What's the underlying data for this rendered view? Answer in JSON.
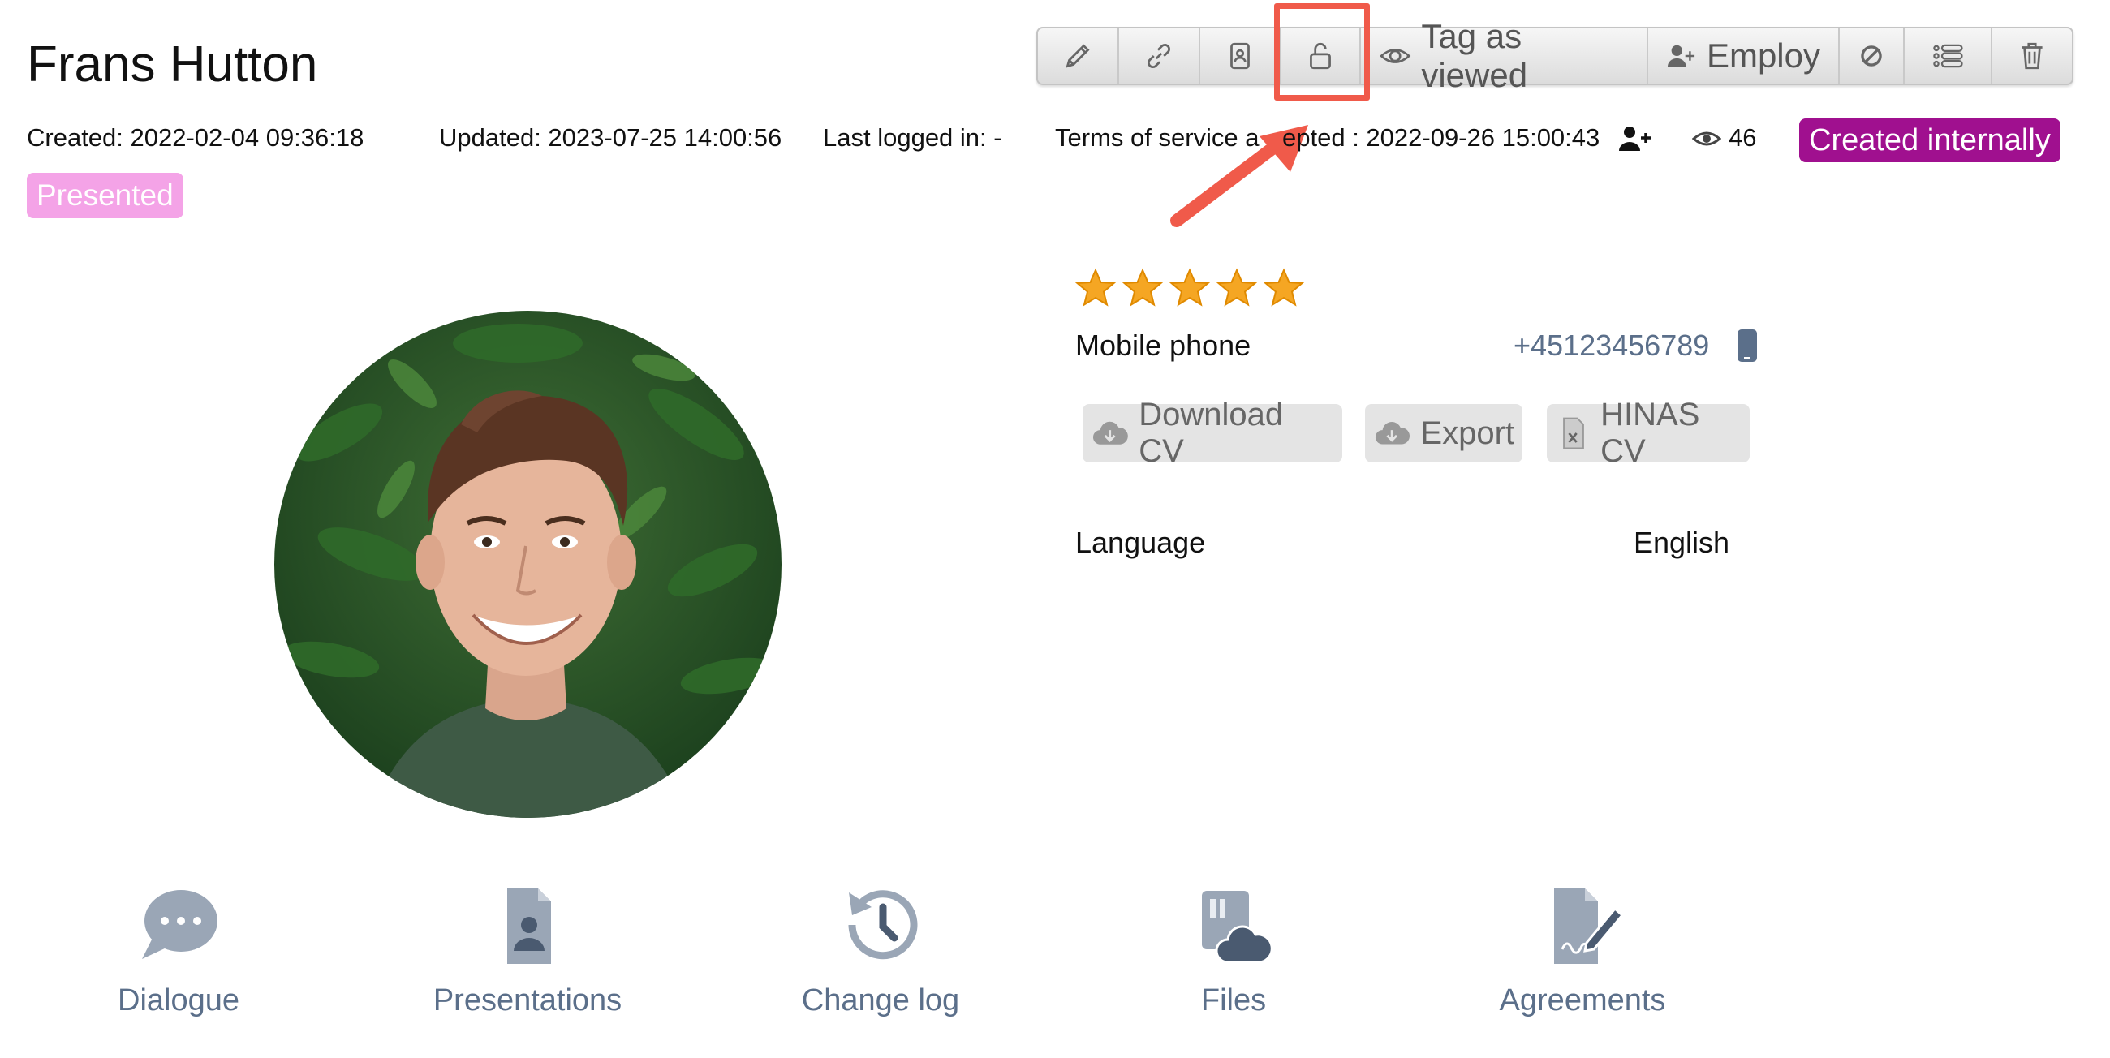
{
  "header": {
    "name": "Frans Hutton"
  },
  "toolbar": {
    "buttons": [
      {
        "icon": "pencil-icon",
        "label": ""
      },
      {
        "icon": "link-icon",
        "label": ""
      },
      {
        "icon": "contact-card-icon",
        "label": ""
      },
      {
        "icon": "unlock-icon",
        "label": ""
      },
      {
        "icon": "eye-icon",
        "label": "Tag as viewed"
      },
      {
        "icon": "user-plus-icon",
        "label": "Employ"
      },
      {
        "icon": "block-icon",
        "label": ""
      },
      {
        "icon": "list-icon",
        "label": ""
      },
      {
        "icon": "trash-icon",
        "label": ""
      }
    ],
    "tag_label": "Tag as viewed",
    "employ_label": "Employ"
  },
  "meta": {
    "created": "Created: 2022-02-04 09:36:18",
    "updated": "Updated: 2023-07-25 14:00:56",
    "last_logged_in": "Last logged in:   -",
    "terms_prefix": "Terms of service a",
    "terms_suffix": "epted : 2022-09-26 15:00:43",
    "views": "46",
    "badge_internal": "Created internally",
    "badge_presented": "Presented"
  },
  "colors": {
    "badge_internal": "#a0108f",
    "badge_presented": "#f4a3e7",
    "highlight": "#f05a4a",
    "link_gray_blue": "#5b6f8a"
  },
  "profile": {
    "rating": 5,
    "rating_max": 5,
    "mobile_label": "Mobile phone",
    "mobile_value": "+45123456789",
    "language_label": "Language",
    "language_value": "English"
  },
  "actions": {
    "download_cv": "Download CV",
    "export": "Export",
    "hinas_cv": "HINAS CV"
  },
  "bottom_nav": {
    "dialogue": "Dialogue",
    "presentations": "Presentations",
    "change_log": "Change log",
    "files": "Files",
    "agreements": "Agreements"
  }
}
